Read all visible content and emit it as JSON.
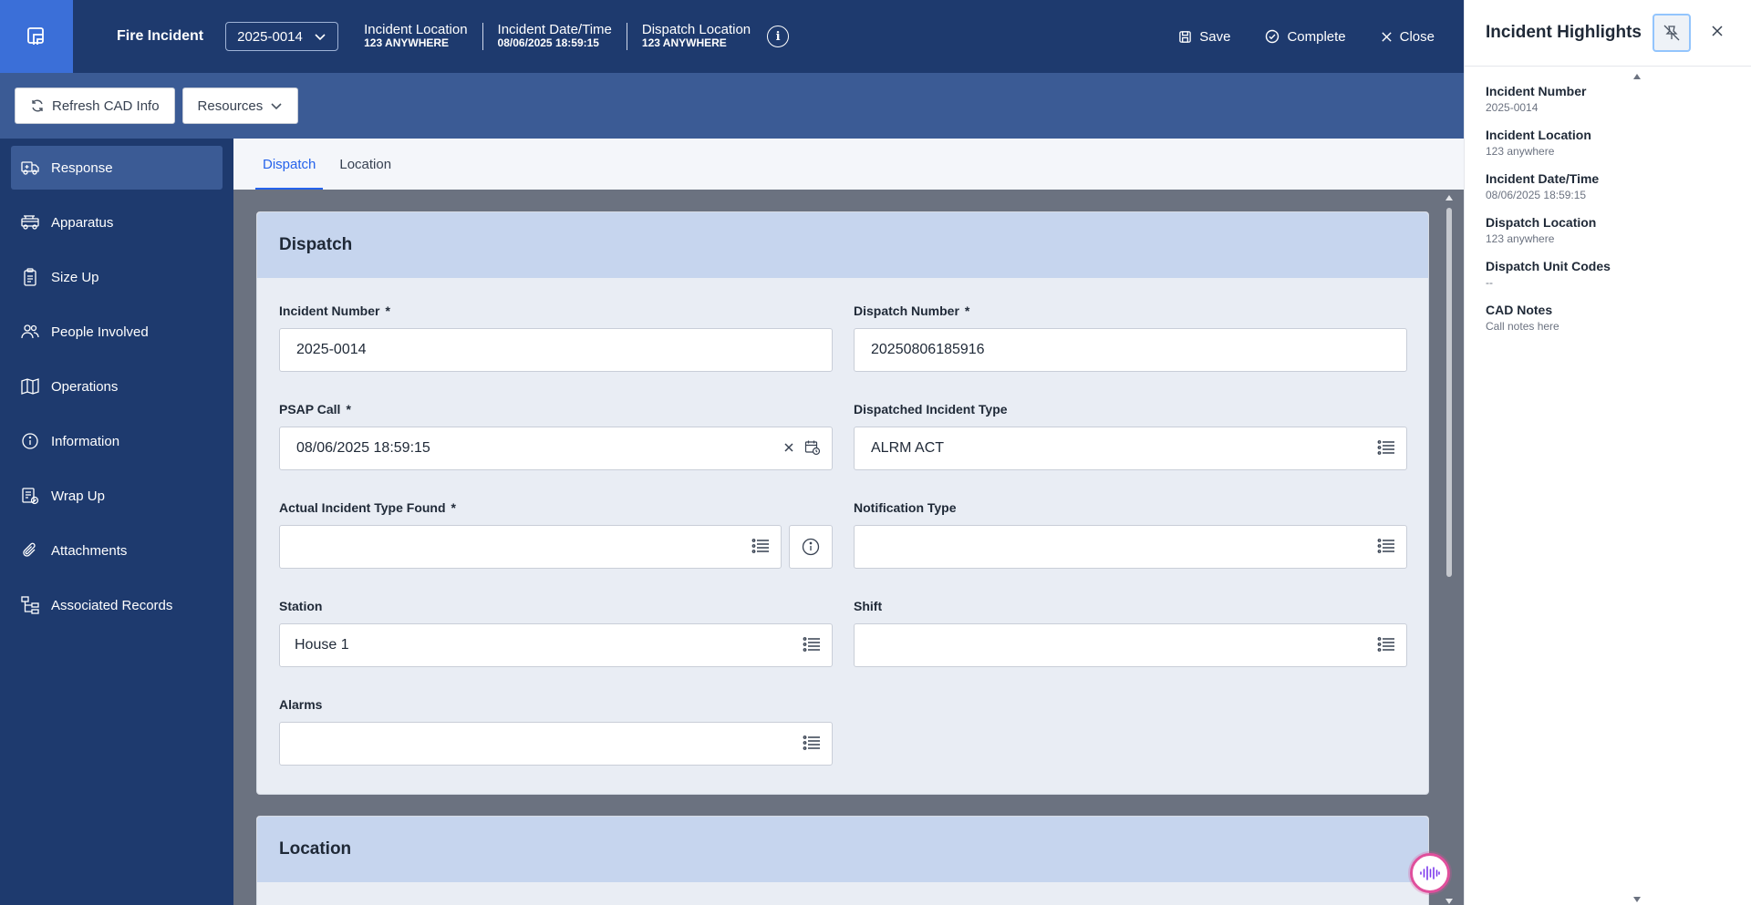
{
  "header": {
    "app_title": "Fire Incident",
    "incident_select": "2025-0014",
    "meta": [
      {
        "label": "Incident Location",
        "value": "123 ANYWHERE"
      },
      {
        "label": "Incident Date/Time",
        "value": "08/06/2025 18:59:15"
      },
      {
        "label": "Dispatch Location",
        "value": "123 ANYWHERE"
      }
    ],
    "actions": {
      "save": "Save",
      "complete": "Complete",
      "close": "Close"
    }
  },
  "subbar": {
    "refresh": "Refresh CAD Info",
    "resources": "Resources"
  },
  "sidebar": {
    "items": [
      {
        "label": "Response",
        "icon": "ambulance-icon"
      },
      {
        "label": "Apparatus",
        "icon": "fire-truck-icon"
      },
      {
        "label": "Size Up",
        "icon": "clipboard-icon"
      },
      {
        "label": "People Involved",
        "icon": "people-icon"
      },
      {
        "label": "Operations",
        "icon": "map-icon"
      },
      {
        "label": "Information",
        "icon": "info-icon"
      },
      {
        "label": "Wrap Up",
        "icon": "checklist-icon"
      },
      {
        "label": "Attachments",
        "icon": "paperclip-icon"
      },
      {
        "label": "Associated Records",
        "icon": "hierarchy-icon"
      }
    ]
  },
  "tabs": [
    "Dispatch",
    "Location"
  ],
  "dispatch": {
    "title": "Dispatch",
    "incident_number": {
      "label": "Incident Number",
      "value": "2025-0014"
    },
    "dispatch_number": {
      "label": "Dispatch Number",
      "value": "20250806185916"
    },
    "psap_call": {
      "label": "PSAP Call",
      "value": "08/06/2025 18:59:15"
    },
    "dispatched_type": {
      "label": "Dispatched Incident Type",
      "value": "ALRM ACT"
    },
    "actual_type": {
      "label": "Actual Incident Type Found",
      "value": ""
    },
    "notification_type": {
      "label": "Notification Type",
      "value": ""
    },
    "station": {
      "label": "Station",
      "value": "House 1"
    },
    "shift": {
      "label": "Shift",
      "value": ""
    },
    "alarms": {
      "label": "Alarms",
      "value": ""
    },
    "required_mark": "*"
  },
  "location": {
    "title": "Location"
  },
  "highlights": {
    "title": "Incident Highlights",
    "items": [
      {
        "label": "Incident Number",
        "value": "2025-0014"
      },
      {
        "label": "Incident Location",
        "value": "123 anywhere"
      },
      {
        "label": "Incident Date/Time",
        "value": "08/06/2025 18:59:15"
      },
      {
        "label": "Dispatch Location",
        "value": "123 anywhere"
      },
      {
        "label": "Dispatch Unit Codes",
        "value": "--"
      },
      {
        "label": "CAD Notes",
        "value": "Call notes here"
      }
    ]
  }
}
